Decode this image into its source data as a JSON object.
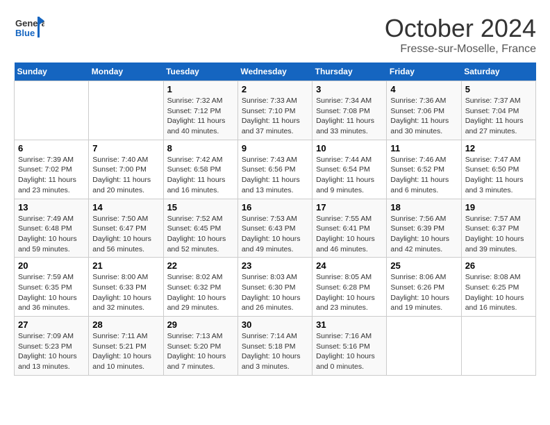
{
  "header": {
    "logo_line1": "General",
    "logo_line2": "Blue",
    "month": "October 2024",
    "location": "Fresse-sur-Moselle, France"
  },
  "weekdays": [
    "Sunday",
    "Monday",
    "Tuesday",
    "Wednesday",
    "Thursday",
    "Friday",
    "Saturday"
  ],
  "weeks": [
    [
      {
        "day": "",
        "info": ""
      },
      {
        "day": "",
        "info": ""
      },
      {
        "day": "1",
        "info": "Sunrise: 7:32 AM\nSunset: 7:12 PM\nDaylight: 11 hours and 40 minutes."
      },
      {
        "day": "2",
        "info": "Sunrise: 7:33 AM\nSunset: 7:10 PM\nDaylight: 11 hours and 37 minutes."
      },
      {
        "day": "3",
        "info": "Sunrise: 7:34 AM\nSunset: 7:08 PM\nDaylight: 11 hours and 33 minutes."
      },
      {
        "day": "4",
        "info": "Sunrise: 7:36 AM\nSunset: 7:06 PM\nDaylight: 11 hours and 30 minutes."
      },
      {
        "day": "5",
        "info": "Sunrise: 7:37 AM\nSunset: 7:04 PM\nDaylight: 11 hours and 27 minutes."
      }
    ],
    [
      {
        "day": "6",
        "info": "Sunrise: 7:39 AM\nSunset: 7:02 PM\nDaylight: 11 hours and 23 minutes."
      },
      {
        "day": "7",
        "info": "Sunrise: 7:40 AM\nSunset: 7:00 PM\nDaylight: 11 hours and 20 minutes."
      },
      {
        "day": "8",
        "info": "Sunrise: 7:42 AM\nSunset: 6:58 PM\nDaylight: 11 hours and 16 minutes."
      },
      {
        "day": "9",
        "info": "Sunrise: 7:43 AM\nSunset: 6:56 PM\nDaylight: 11 hours and 13 minutes."
      },
      {
        "day": "10",
        "info": "Sunrise: 7:44 AM\nSunset: 6:54 PM\nDaylight: 11 hours and 9 minutes."
      },
      {
        "day": "11",
        "info": "Sunrise: 7:46 AM\nSunset: 6:52 PM\nDaylight: 11 hours and 6 minutes."
      },
      {
        "day": "12",
        "info": "Sunrise: 7:47 AM\nSunset: 6:50 PM\nDaylight: 11 hours and 3 minutes."
      }
    ],
    [
      {
        "day": "13",
        "info": "Sunrise: 7:49 AM\nSunset: 6:48 PM\nDaylight: 10 hours and 59 minutes."
      },
      {
        "day": "14",
        "info": "Sunrise: 7:50 AM\nSunset: 6:47 PM\nDaylight: 10 hours and 56 minutes."
      },
      {
        "day": "15",
        "info": "Sunrise: 7:52 AM\nSunset: 6:45 PM\nDaylight: 10 hours and 52 minutes."
      },
      {
        "day": "16",
        "info": "Sunrise: 7:53 AM\nSunset: 6:43 PM\nDaylight: 10 hours and 49 minutes."
      },
      {
        "day": "17",
        "info": "Sunrise: 7:55 AM\nSunset: 6:41 PM\nDaylight: 10 hours and 46 minutes."
      },
      {
        "day": "18",
        "info": "Sunrise: 7:56 AM\nSunset: 6:39 PM\nDaylight: 10 hours and 42 minutes."
      },
      {
        "day": "19",
        "info": "Sunrise: 7:57 AM\nSunset: 6:37 PM\nDaylight: 10 hours and 39 minutes."
      }
    ],
    [
      {
        "day": "20",
        "info": "Sunrise: 7:59 AM\nSunset: 6:35 PM\nDaylight: 10 hours and 36 minutes."
      },
      {
        "day": "21",
        "info": "Sunrise: 8:00 AM\nSunset: 6:33 PM\nDaylight: 10 hours and 32 minutes."
      },
      {
        "day": "22",
        "info": "Sunrise: 8:02 AM\nSunset: 6:32 PM\nDaylight: 10 hours and 29 minutes."
      },
      {
        "day": "23",
        "info": "Sunrise: 8:03 AM\nSunset: 6:30 PM\nDaylight: 10 hours and 26 minutes."
      },
      {
        "day": "24",
        "info": "Sunrise: 8:05 AM\nSunset: 6:28 PM\nDaylight: 10 hours and 23 minutes."
      },
      {
        "day": "25",
        "info": "Sunrise: 8:06 AM\nSunset: 6:26 PM\nDaylight: 10 hours and 19 minutes."
      },
      {
        "day": "26",
        "info": "Sunrise: 8:08 AM\nSunset: 6:25 PM\nDaylight: 10 hours and 16 minutes."
      }
    ],
    [
      {
        "day": "27",
        "info": "Sunrise: 7:09 AM\nSunset: 5:23 PM\nDaylight: 10 hours and 13 minutes."
      },
      {
        "day": "28",
        "info": "Sunrise: 7:11 AM\nSunset: 5:21 PM\nDaylight: 10 hours and 10 minutes."
      },
      {
        "day": "29",
        "info": "Sunrise: 7:13 AM\nSunset: 5:20 PM\nDaylight: 10 hours and 7 minutes."
      },
      {
        "day": "30",
        "info": "Sunrise: 7:14 AM\nSunset: 5:18 PM\nDaylight: 10 hours and 3 minutes."
      },
      {
        "day": "31",
        "info": "Sunrise: 7:16 AM\nSunset: 5:16 PM\nDaylight: 10 hours and 0 minutes."
      },
      {
        "day": "",
        "info": ""
      },
      {
        "day": "",
        "info": ""
      }
    ]
  ]
}
